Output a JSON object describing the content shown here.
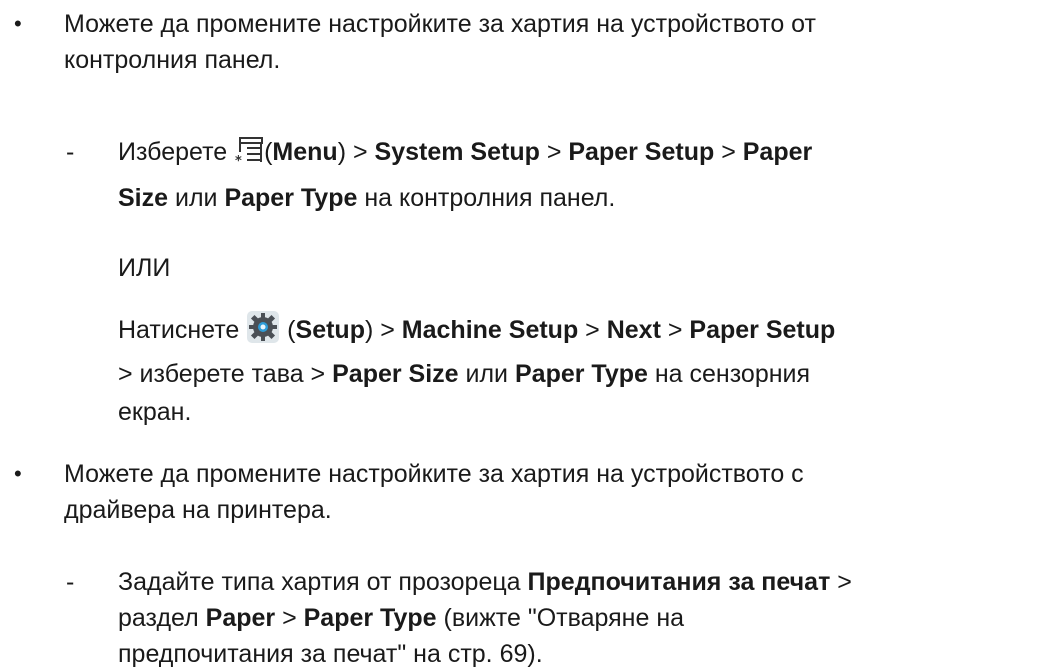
{
  "bullet_marker": "•",
  "dash_marker": "-",
  "section1": {
    "line1": "Можете да промените настройките за хартия на устройството от",
    "line2": "контролния панел.",
    "sub1": {
      "pre_icon": "Изберете ",
      "menu_open": "(",
      "menu": "Menu",
      "menu_close": ") > ",
      "system_setup": "System Setup",
      "sep1": " > ",
      "paper_setup": "Paper Setup",
      "sep2": " > ",
      "paper": "Paper",
      "size": "Size",
      "or": " или ",
      "paper_type": "Paper Type",
      "tail": " на контролния панел."
    },
    "or_label": "ИЛИ",
    "sub2": {
      "pre_icon": "Натиснете ",
      "setup_open": " (",
      "setup": "Setup",
      "setup_close": ") > ",
      "machine_setup": "Machine Setup",
      "sep1": " > ",
      "next": "Next",
      "sep2": " > ",
      "paper_setup": "Paper Setup",
      "line2_pre": "> изберете тава > ",
      "paper_size": "Paper Size",
      "or": " или ",
      "paper_type": "Paper Type",
      "line2_tail": " на сензорния",
      "line3": "екран."
    }
  },
  "section2": {
    "line1": "Можете да промените настройките за хартия на устройството с",
    "line2": "драйвера на принтера.",
    "sub1": {
      "pre": "Задайте типа хартия от прозореца ",
      "pref": "Предпочитания за печат",
      "gt": " >",
      "line2_pre": "раздел ",
      "paper": "Paper",
      "sep": " > ",
      "paper_type": "Paper Type",
      "line2_tail": " (вижте \"Отваряне на",
      "line3": "предпочитания за печат\" на стр. 69)."
    }
  }
}
